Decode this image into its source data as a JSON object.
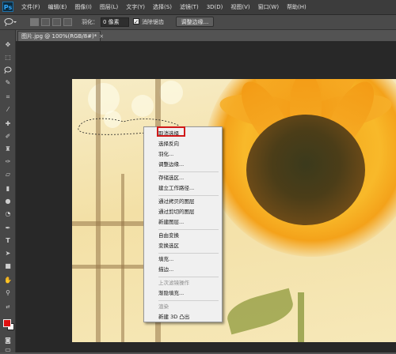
{
  "app": {
    "logo": "Ps",
    "menu": [
      "文件(F)",
      "编辑(E)",
      "图像(I)",
      "图层(L)",
      "文字(Y)",
      "选择(S)",
      "滤镜(T)",
      "3D(D)",
      "视图(V)",
      "窗口(W)",
      "帮助(H)"
    ]
  },
  "options": {
    "feather_label": "羽化：",
    "feather_value": "0 像素",
    "antialias_label": "消除锯齿",
    "antialias_checked": "✓",
    "refine_button": "调整边缘..."
  },
  "document": {
    "tab_title": "图片.jpg @ 100%(RGB/8#)",
    "tab_modified": "*",
    "tab_close": "×"
  },
  "colors": {
    "foreground": "#e01010",
    "background": "#ffffff",
    "highlight": "#d01919"
  },
  "tools": [
    "move-icon",
    "marquee-icon",
    "lasso-icon",
    "quick-select-icon",
    "crop-icon",
    "eyedropper-icon",
    "healing-icon",
    "brush-icon",
    "clone-stamp-icon",
    "history-brush-icon",
    "eraser-icon",
    "gradient-icon",
    "blur-icon",
    "dodge-icon",
    "pen-icon",
    "type-icon",
    "path-select-icon",
    "shape-icon",
    "hand-icon",
    "zoom-icon"
  ],
  "context_menu": {
    "items": [
      {
        "label": "取消选择",
        "enabled": true
      },
      {
        "label": "选择反向",
        "enabled": true
      },
      {
        "label": "羽化...",
        "enabled": true
      },
      {
        "label": "调整边缘...",
        "enabled": true
      },
      {
        "label": "存储选区...",
        "enabled": true
      },
      {
        "label": "建立工作路径...",
        "enabled": true
      },
      {
        "label": "通过拷贝的图层",
        "enabled": true
      },
      {
        "label": "通过剪切的图层",
        "enabled": true
      },
      {
        "label": "新建图层...",
        "enabled": true
      },
      {
        "label": "自由变换",
        "enabled": true
      },
      {
        "label": "变换选区",
        "enabled": true
      },
      {
        "label": "填充...",
        "enabled": true
      },
      {
        "label": "描边...",
        "enabled": true
      },
      {
        "label": "上次滤镜操作",
        "enabled": false
      },
      {
        "label": "渐隐填充...",
        "enabled": true
      },
      {
        "label": "渲染",
        "enabled": false
      },
      {
        "label": "新建 3D 凸出",
        "enabled": true
      }
    ]
  }
}
